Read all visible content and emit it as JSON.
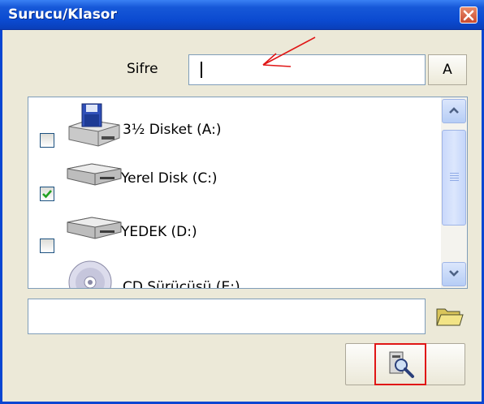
{
  "window": {
    "title": "Surucu/Klasor"
  },
  "password": {
    "label": "Sifre",
    "value": "",
    "button_label": "A"
  },
  "drives": [
    {
      "label": "3½ Disket (A:)",
      "checked": false,
      "icon": "floppy-drive-icon"
    },
    {
      "label": "Yerel Disk (C:)",
      "checked": true,
      "icon": "hard-disk-icon"
    },
    {
      "label": "YEDEK (D:)",
      "checked": false,
      "icon": "hard-disk-icon"
    },
    {
      "label": "CD Sürücüsü (E:)",
      "checked": false,
      "icon": "cd-drive-icon"
    }
  ],
  "path": {
    "value": ""
  },
  "icons": {
    "close": "close-icon",
    "folder": "folder-icon",
    "search": "search-icon",
    "annotation": "red-arrow-annotation"
  },
  "colors": {
    "titlebar": "#0a46d2",
    "dialog_bg": "#ece9d8",
    "annotation": "#e01616",
    "checkmark": "#21a121"
  }
}
